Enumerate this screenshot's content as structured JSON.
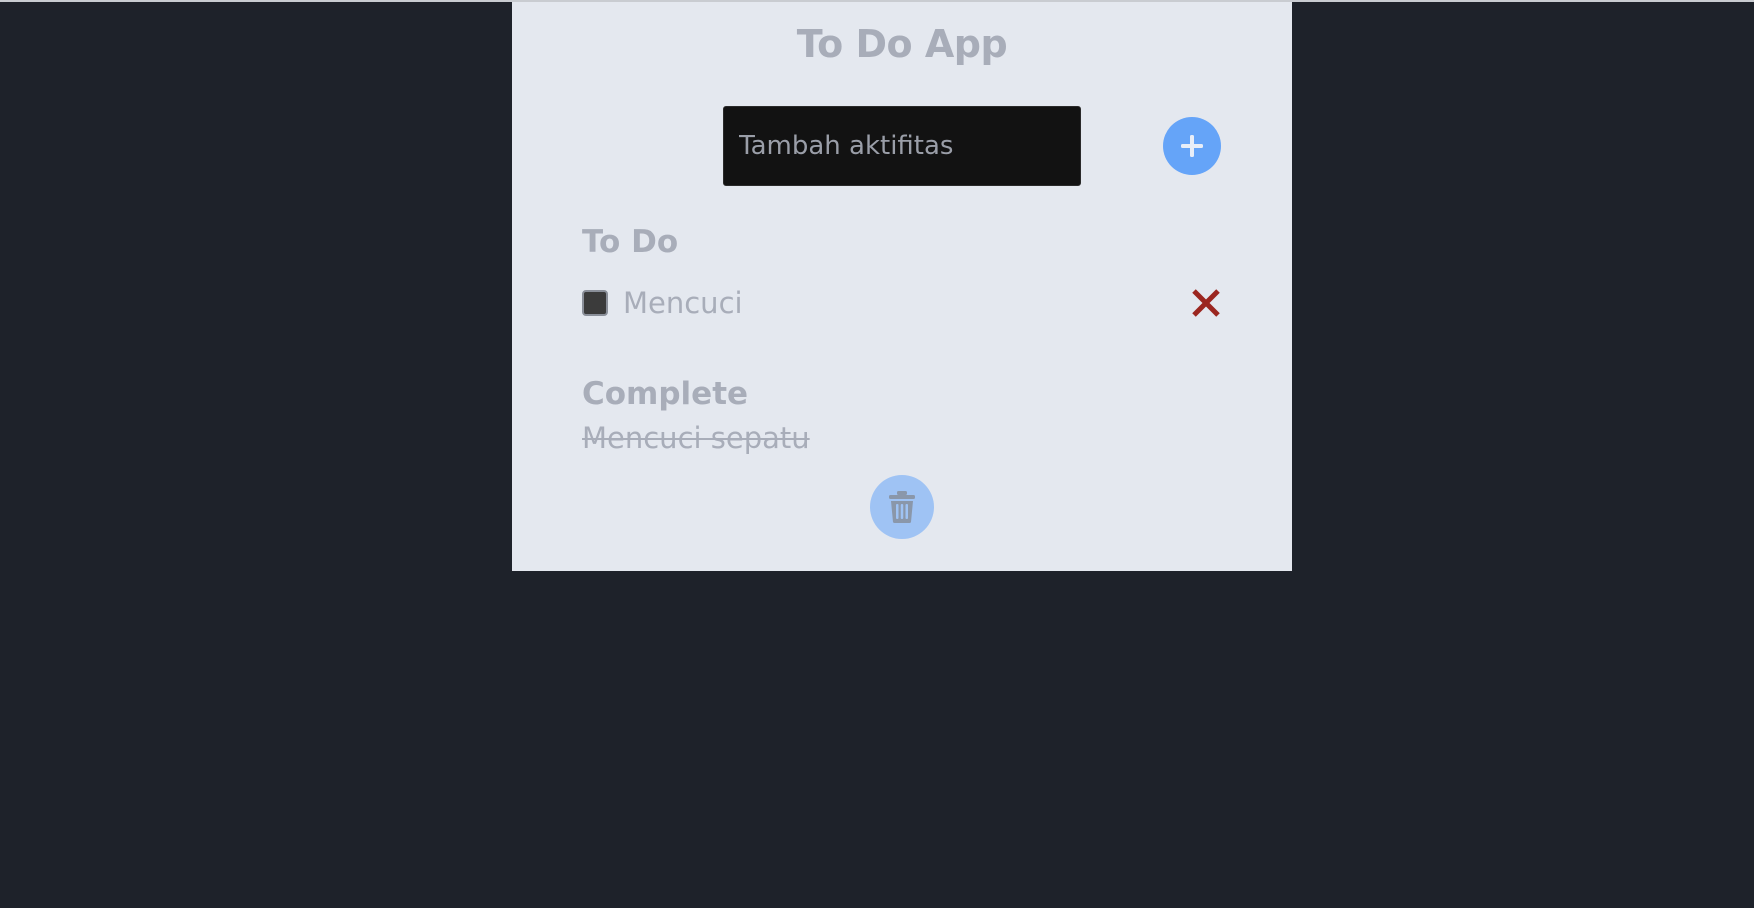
{
  "app": {
    "title": "To Do App"
  },
  "input": {
    "placeholder": "Tambah aktifitas",
    "value": ""
  },
  "buttons": {
    "add_icon": "plus-icon",
    "clear_icon": "trash-icon"
  },
  "todo": {
    "heading": "To Do",
    "items": [
      {
        "label": "Mencuci",
        "checked": false,
        "delete_icon": "close-icon"
      }
    ]
  },
  "complete": {
    "heading": "Complete",
    "items": [
      {
        "label": "Mencuci sepatu"
      }
    ]
  },
  "colors": {
    "page_background": "#1e222a",
    "card_background": "#e4e8ef",
    "accent_blue": "#65a4f8",
    "accent_blue_faded": "#9fc3f4",
    "delete_red": "#9b2620",
    "muted_text": "#a8adb9"
  }
}
